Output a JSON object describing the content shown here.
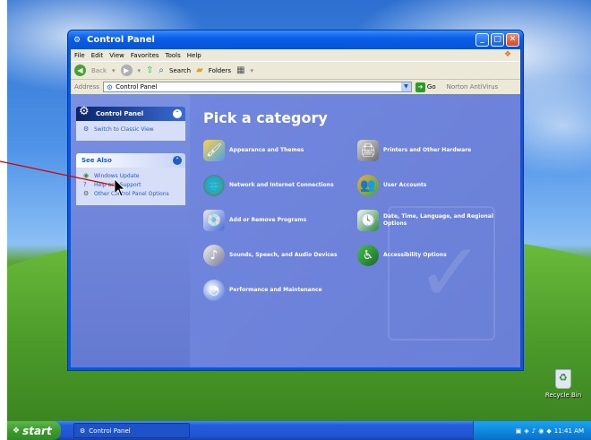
{
  "window": {
    "title": "Control Panel"
  },
  "menubar": {
    "items": [
      "File",
      "Edit",
      "View",
      "Favorites",
      "Tools",
      "Help"
    ]
  },
  "toolbar": {
    "back_label": "Back",
    "search_label": "Search",
    "folders_label": "Folders"
  },
  "addressbar": {
    "label": "Address",
    "value": "Control Panel",
    "go_label": "Go",
    "norton_label": "Norton AntiVirus"
  },
  "sidebar": {
    "control_panel_title": "Control Panel",
    "switch_view": "Switch to Classic View",
    "see_also_title": "See Also",
    "see_also_items": [
      "Windows Update",
      "Help and Support",
      "Other Control Panel Options"
    ]
  },
  "main": {
    "heading": "Pick a category",
    "categories_left": [
      "Appearance and Themes",
      "Network and Internet Connections",
      "Add or Remove Programs",
      "Sounds, Speech, and Audio Devices",
      "Performance and Maintenance"
    ],
    "categories_right": [
      "Printers and Other Hardware",
      "User Accounts",
      "Date, Time, Language, and Regional Options",
      "Accessibility Options"
    ]
  },
  "desktop": {
    "recycle_bin_label": "Recycle Bin"
  },
  "taskbar": {
    "start_label": "start",
    "task_label": "Control Panel",
    "clock": "11:41 AM"
  },
  "colors": {
    "titlebar_blue": "#0a5fe8",
    "panel_blue": "#6b80d8",
    "start_green": "#3d9b2f",
    "annotation_red": "#d40000"
  }
}
